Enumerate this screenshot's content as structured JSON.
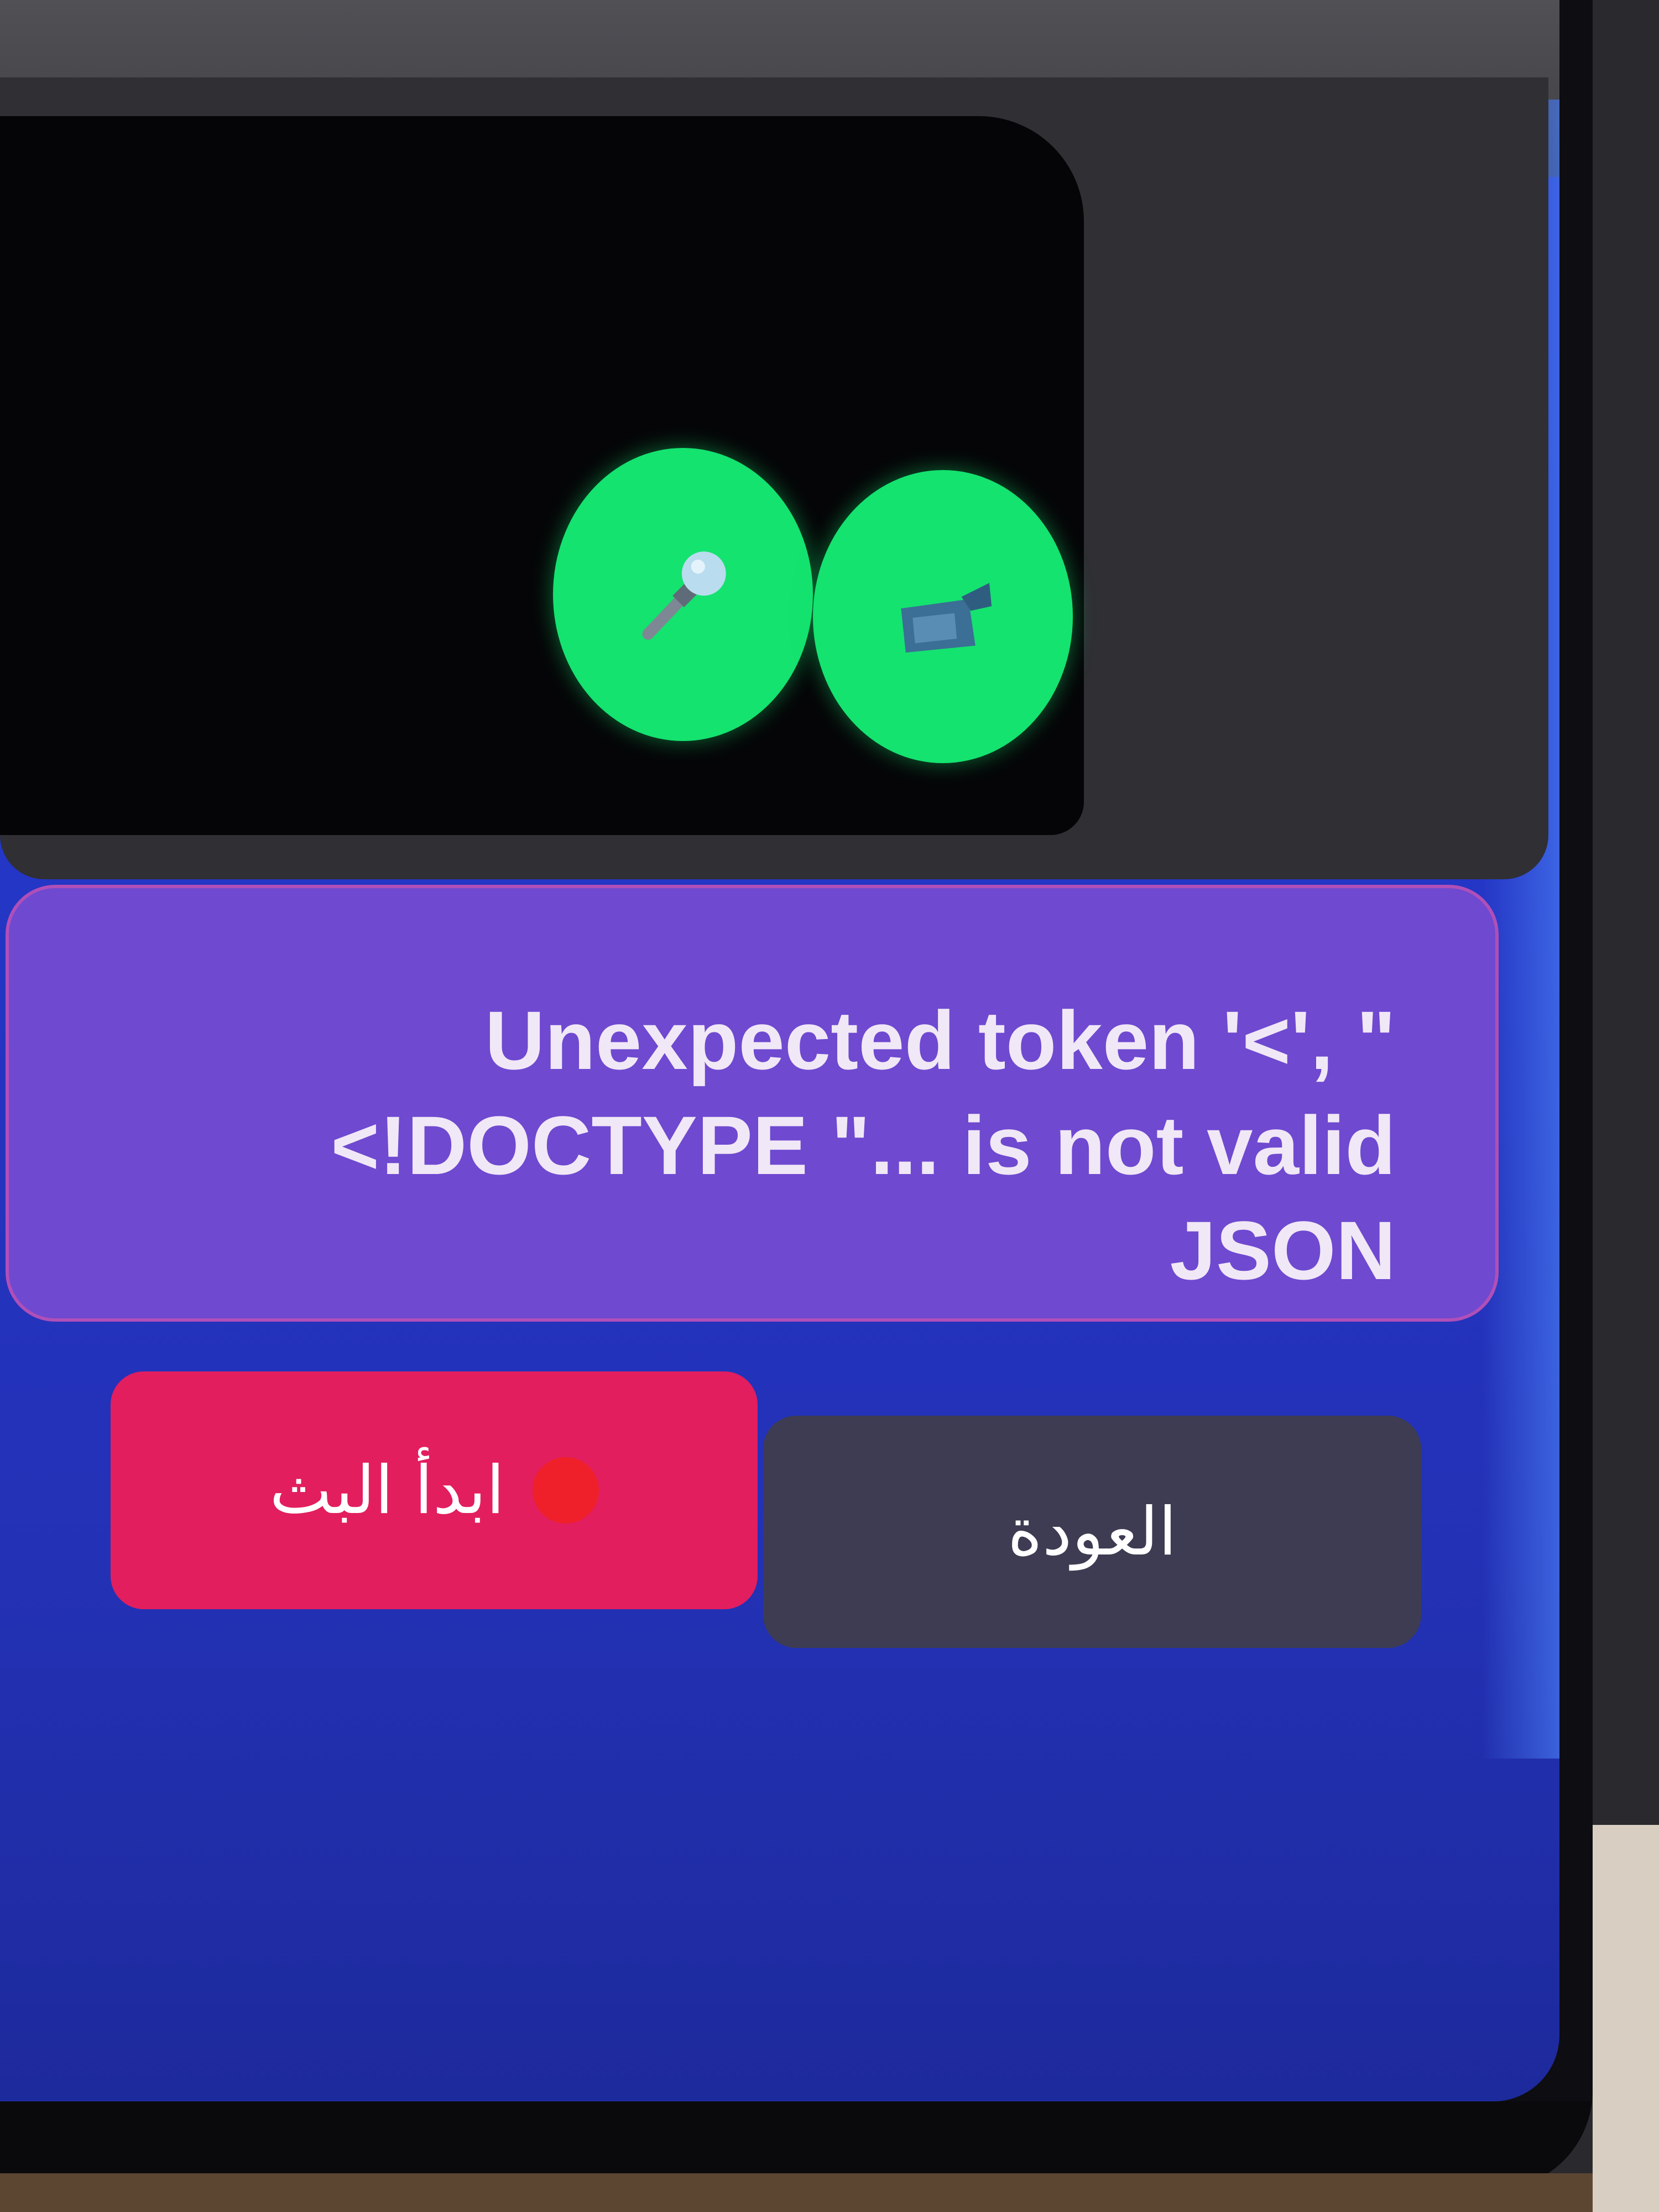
{
  "call_controls": {
    "mic_icon": "microphone-icon",
    "camera_icon": "video-camera-icon",
    "button_color": "#14e36f"
  },
  "error": {
    "message": "Unexpected token '<', \"<!DOCTYPE \"... is not valid JSON"
  },
  "actions": {
    "start_label": "ابدأ البث",
    "back_label": "العودة",
    "start_color": "#e21e5e",
    "back_color": "#3d3c52",
    "live_dot_icon": "red-circle-icon"
  }
}
